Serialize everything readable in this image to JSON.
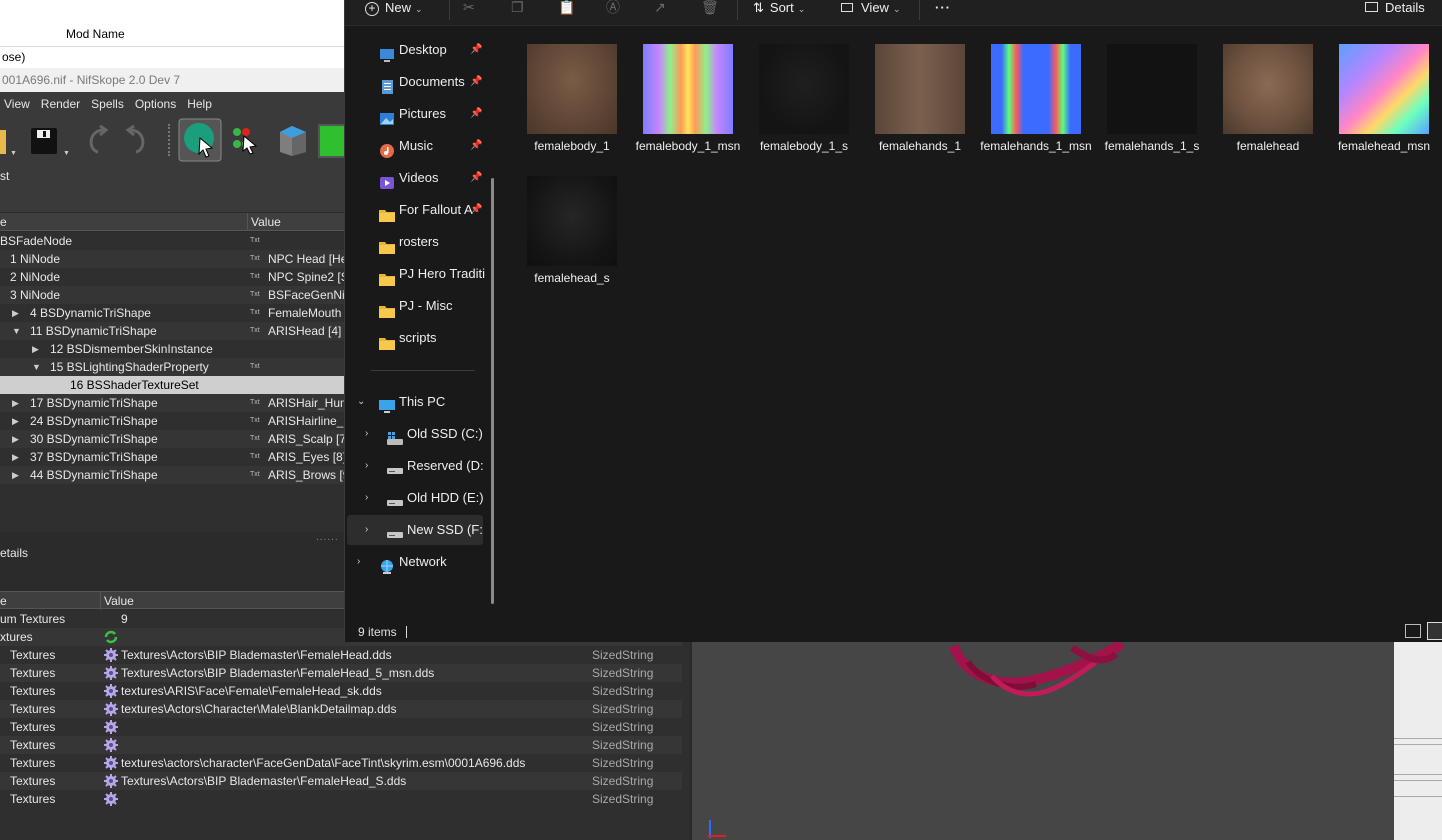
{
  "mod_organizer": {
    "column_header": "Mod Name",
    "row_text": "ose)"
  },
  "nifskope": {
    "title": "001A696.nif - NifSkope 2.0 Dev 7",
    "menu": [
      "View",
      "Render",
      "Spells",
      "Options",
      "Help"
    ],
    "dock_label": "st",
    "tree_header": {
      "name": "e",
      "value": "Value"
    },
    "tree_rows": [
      {
        "indent": 0,
        "arrow": "",
        "name": "BSFadeNode",
        "value": "",
        "txt": true,
        "alt": false,
        "selected": false
      },
      {
        "indent": 10,
        "arrow": "",
        "name": "1 NiNode",
        "value": "NPC Head [He",
        "txt": true,
        "alt": true,
        "selected": false
      },
      {
        "indent": 10,
        "arrow": "",
        "name": "2 NiNode",
        "value": "NPC Spine2 [S",
        "txt": true,
        "alt": false,
        "selected": false
      },
      {
        "indent": 10,
        "arrow": "",
        "name": "3 NiNode",
        "value": "BSFaceGenNi",
        "txt": true,
        "alt": true,
        "selected": false
      },
      {
        "indent": 30,
        "arrow": "right",
        "name": "4 BSDynamicTriShape",
        "value": "FemaleMouth",
        "txt": true,
        "alt": false,
        "selected": false
      },
      {
        "indent": 30,
        "arrow": "down",
        "name": "11 BSDynamicTriShape",
        "value": "ARISHead [4]",
        "txt": true,
        "alt": true,
        "selected": false
      },
      {
        "indent": 50,
        "arrow": "right",
        "name": "12 BSDismemberSkinInstance",
        "value": "",
        "txt": false,
        "alt": false,
        "selected": false
      },
      {
        "indent": 50,
        "arrow": "down",
        "name": "15 BSLightingShaderProperty",
        "value": "",
        "txt": true,
        "alt": true,
        "selected": false
      },
      {
        "indent": 70,
        "arrow": "",
        "name": "16 BSShaderTextureSet",
        "value": "",
        "txt": false,
        "alt": false,
        "selected": true
      },
      {
        "indent": 30,
        "arrow": "right",
        "name": "17 BSDynamicTriShape",
        "value": "ARISHair_Hum",
        "txt": true,
        "alt": true,
        "selected": false
      },
      {
        "indent": 30,
        "arrow": "right",
        "name": "24 BSDynamicTriShape",
        "value": "ARISHairline_H",
        "txt": true,
        "alt": false,
        "selected": false
      },
      {
        "indent": 30,
        "arrow": "right",
        "name": "30 BSDynamicTriShape",
        "value": "ARIS_Scalp [7]",
        "txt": true,
        "alt": true,
        "selected": false
      },
      {
        "indent": 30,
        "arrow": "right",
        "name": "37 BSDynamicTriShape",
        "value": "ARIS_Eyes [8]",
        "txt": true,
        "alt": false,
        "selected": false
      },
      {
        "indent": 30,
        "arrow": "right",
        "name": "44 BSDynamicTriShape",
        "value": "ARIS_Brows [9]",
        "txt": true,
        "alt": true,
        "selected": false
      }
    ],
    "details_label": "etails",
    "block_header": {
      "name": "e",
      "value": "Value"
    },
    "block_rows": [
      {
        "name": "um Textures",
        "value": "9",
        "type": "",
        "icon": "none",
        "nx": 0
      },
      {
        "name": "xtures",
        "value": "",
        "type": "",
        "icon": "refresh",
        "nx": 0
      },
      {
        "name": "Textures",
        "value": "Textures\\Actors\\BIP Blademaster\\FemaleHead.dds",
        "type": "SizedString",
        "icon": "gear",
        "nx": 10
      },
      {
        "name": "Textures",
        "value": "Textures\\Actors\\BIP Blademaster\\FemaleHead_5_msn.dds",
        "type": "SizedString",
        "icon": "gear",
        "nx": 10
      },
      {
        "name": "Textures",
        "value": "textures\\ARIS\\Face\\Female\\FemaleHead_sk.dds",
        "type": "SizedString",
        "icon": "gear",
        "nx": 10
      },
      {
        "name": "Textures",
        "value": "textures\\Actors\\Character\\Male\\BlankDetailmap.dds",
        "type": "SizedString",
        "icon": "gear",
        "nx": 10
      },
      {
        "name": "Textures",
        "value": "",
        "type": "SizedString",
        "icon": "gear",
        "nx": 10
      },
      {
        "name": "Textures",
        "value": "",
        "type": "SizedString",
        "icon": "gear",
        "nx": 10
      },
      {
        "name": "Textures",
        "value": "textures\\actors\\character\\FaceGenData\\FaceTint\\skyrim.esm\\0001A696.dds",
        "type": "SizedString",
        "icon": "gear",
        "nx": 10
      },
      {
        "name": "Textures",
        "value": "Textures\\Actors\\BIP Blademaster\\FemaleHead_S.dds",
        "type": "SizedString",
        "icon": "gear",
        "nx": 10
      },
      {
        "name": "Textures",
        "value": "",
        "type": "SizedString",
        "icon": "gear",
        "nx": 10
      }
    ]
  },
  "explorer": {
    "toolbar": {
      "new_label": "New",
      "sort_label": "Sort",
      "view_label": "View",
      "more_label": "···",
      "details_label": "Details"
    },
    "nav_quick": [
      {
        "label": "Desktop",
        "icon": "desktop",
        "pinned": true
      },
      {
        "label": "Documents",
        "icon": "documents",
        "pinned": true
      },
      {
        "label": "Pictures",
        "icon": "pictures",
        "pinned": true
      },
      {
        "label": "Music",
        "icon": "music",
        "pinned": true
      },
      {
        "label": "Videos",
        "icon": "videos",
        "pinned": true
      },
      {
        "label": "For Fallout A",
        "icon": "folder",
        "pinned": true
      },
      {
        "label": "rosters",
        "icon": "folder",
        "pinned": false
      },
      {
        "label": "PJ Hero Tradition",
        "icon": "folder",
        "pinned": false
      },
      {
        "label": "PJ - Misc",
        "icon": "folder",
        "pinned": false
      },
      {
        "label": "scripts",
        "icon": "folder",
        "pinned": false
      }
    ],
    "this_pc": "This PC",
    "drives": [
      {
        "label": "Old SSD (C:)",
        "icon": "windows-drive",
        "selected": false
      },
      {
        "label": "Reserved (D:)",
        "icon": "drive",
        "selected": false
      },
      {
        "label": "Old HDD (E:)",
        "icon": "drive",
        "selected": false
      },
      {
        "label": "New SSD (F:)",
        "icon": "drive",
        "selected": true
      }
    ],
    "network": "Network",
    "files": [
      {
        "name": "femalebody_1",
        "thumb": "body-diffuse"
      },
      {
        "name": "femalebody_1_msn",
        "thumb": "body-normal"
      },
      {
        "name": "femalebody_1_s",
        "thumb": "body-specular"
      },
      {
        "name": "femalehands_1",
        "thumb": "hands-diffuse"
      },
      {
        "name": "femalehands_1_msn",
        "thumb": "hands-normal"
      },
      {
        "name": "femalehands_1_s",
        "thumb": "hands-specular"
      },
      {
        "name": "femalehead",
        "thumb": "head-diffuse"
      },
      {
        "name": "femalehead_msn",
        "thumb": "head-normal"
      },
      {
        "name": "femalehead_s",
        "thumb": "head-specular"
      }
    ],
    "status": "9 items"
  }
}
